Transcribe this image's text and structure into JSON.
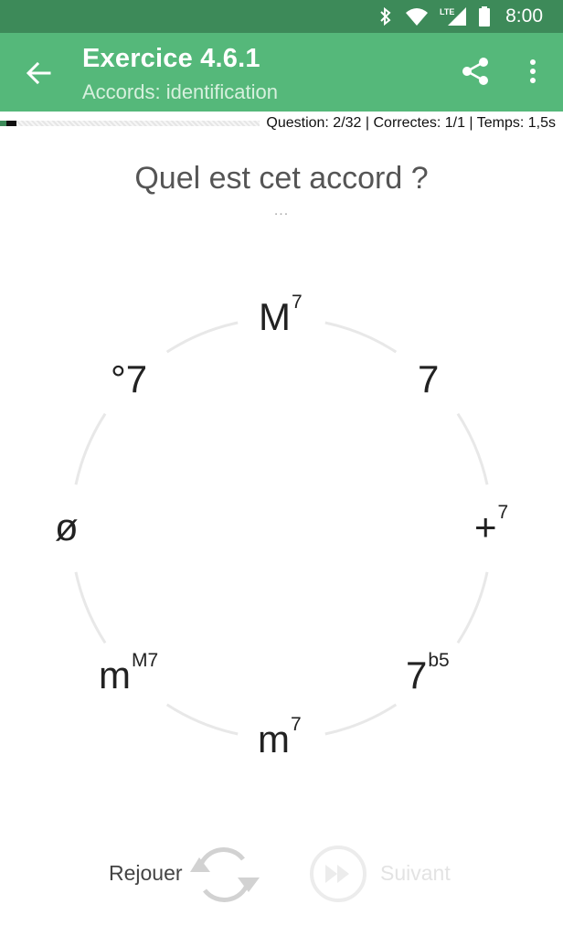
{
  "status_bar": {
    "time": "8:00",
    "network": "LTE"
  },
  "app_bar": {
    "title": "Exercice 4.6.1",
    "subtitle": "Accords: identification"
  },
  "progress": {
    "fraction": 0.0625,
    "stats": "Question: 2/32 | Correctes: 1/1 | Temps: 1,5s"
  },
  "question": {
    "text": "Quel est cet accord ?",
    "dots": "..."
  },
  "chords": [
    {
      "base": "M",
      "sup": "7"
    },
    {
      "base": "7",
      "sup": ""
    },
    {
      "base": "+",
      "sup": "7"
    },
    {
      "base": "7",
      "sup": "b5"
    },
    {
      "base": "m",
      "sup": "7"
    },
    {
      "base": "m",
      "sup": "M7"
    },
    {
      "base": "ø",
      "sup": ""
    },
    {
      "base": "°7",
      "sup": ""
    }
  ],
  "controls": {
    "replay_label": "Rejouer",
    "next_label": "Suivant"
  },
  "colors": {
    "status_bar": "#3d8a59",
    "app_bar": "#55b87a",
    "ring": "#e8e8e8"
  },
  "icons": [
    "bluetooth-icon",
    "wifi-icon",
    "signal-icon",
    "battery-icon",
    "back-arrow-icon",
    "share-icon",
    "more-vert-icon",
    "replay-icon",
    "fast-forward-icon"
  ]
}
